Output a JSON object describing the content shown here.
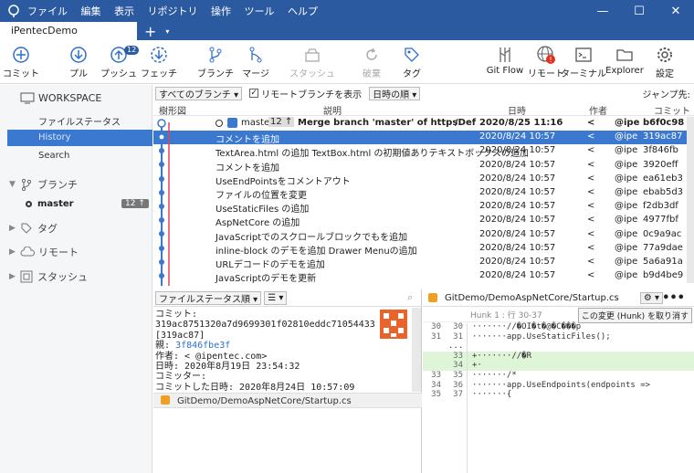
{
  "menu": {
    "items": [
      "ファイル",
      "編集",
      "表示",
      "リポジトリ",
      "操作",
      "ツール",
      "ヘルプ"
    ]
  },
  "window": {
    "min": "—",
    "max": "☐",
    "close": "✕"
  },
  "tab": {
    "title": "iPentecDemo",
    "plus": "+",
    "drop": "▾"
  },
  "toolbar": {
    "commit": "コミット",
    "pull": "プル",
    "push": "プッシュ",
    "push_badge": "12",
    "fetch": "フェッチ",
    "branch": "ブランチ",
    "merge": "マージ",
    "stash": "スタッシュ",
    "discard": "破棄",
    "tag": "タグ",
    "gitflow": "Git Flow",
    "remote": "リモート",
    "terminal": "ターミナル",
    "explorer": "Explorer",
    "settings": "設定"
  },
  "sidebar": {
    "workspace": "WORKSPACE",
    "file_status": "ファイルステータス",
    "history": "History",
    "search": "Search",
    "branches": "ブランチ",
    "master": "master",
    "master_badge": "12 ↑",
    "tags": "タグ",
    "remotes": "リモート",
    "stashes": "スタッシュ"
  },
  "histbar": {
    "branches_dd": "すべてのブランチ ▾",
    "show_remote": "リモートブランチを表示",
    "order_dd": "日時の順 ▾",
    "jump": "ジャンプ先:"
  },
  "columns": {
    "graph": "樹形図",
    "desc": "説明",
    "date": "日時",
    "author": "作者",
    "commit": "コミット"
  },
  "commits": [
    {
      "branch": "master",
      "badge": "12 ↑",
      "desc": "Merge branch 'master' of https:",
      "path": "/Def",
      "date": "2020/8/25 11:16",
      "author": "<",
      "email": "@ipe",
      "hash": "b6f0c98"
    },
    {
      "desc": "コメントを追加",
      "date": "2020/8/24 10:57",
      "author": "<",
      "email": "@ipe",
      "hash": "319ac87"
    },
    {
      "desc": "TextArea.html の追加 TextBox.html の初期値ありテキストボックスの追加",
      "date": "2020/8/24 10:57",
      "author": "<",
      "email": "@ipe",
      "hash": "3f846fb"
    },
    {
      "desc": "コメントを追加",
      "date": "2020/8/24 10:57",
      "author": "<",
      "email": "@ipe",
      "hash": "3920eff"
    },
    {
      "desc": "UseEndPointsをコメントアウト",
      "date": "2020/8/24 10:57",
      "author": "<",
      "email": "@ipe",
      "hash": "ea61eb3"
    },
    {
      "desc": "ファイルの位置を変更",
      "date": "2020/8/24 10:57",
      "author": "<",
      "email": "@ipe",
      "hash": "ebab5d3"
    },
    {
      "desc": "UseStaticFiles の追加",
      "date": "2020/8/24 10:57",
      "author": "<",
      "email": "@ipe",
      "hash": "f2db3df"
    },
    {
      "desc": "AspNetCore の追加",
      "date": "2020/8/24 10:57",
      "author": "<",
      "email": "@ipe",
      "hash": "4977fbf"
    },
    {
      "desc": "JavaScriptでのスクロールブロックでもを追加",
      "date": "2020/8/24 10:57",
      "author": "<",
      "email": "@ipe",
      "hash": "0c9a9ac"
    },
    {
      "desc": "inline-block のデモを追加 Drawer Menuの追加",
      "date": "2020/8/24 10:57",
      "author": "<",
      "email": "@ipe",
      "hash": "77a9dae"
    },
    {
      "desc": "URLデコードのデモを追加",
      "date": "2020/8/24 10:57",
      "author": "<",
      "email": "@ipe",
      "hash": "5a6a91a"
    },
    {
      "desc": "JavaScriptのデモを更新",
      "date": "2020/8/24 10:57",
      "author": "<",
      "email": "@ipe",
      "hash": "b9d4be9"
    }
  ],
  "fileview": {
    "sort_dd": "ファイルステータス順 ▾",
    "list_dd": "☰ ▾"
  },
  "commitinfo": {
    "l1": "コミット:",
    "l2": "319ac8751320a7d9699301f02810eddc71054433",
    "l3": "[319ac87]",
    "l4_label": "親:",
    "l4_val": "3f846fbe3f",
    "l5": "作者:       <      @ipentec.com>",
    "l6": "日時: 2020年8月19日 23:54:32",
    "l7": "コミッター:",
    "l8": "コミットした日時: 2020年8月24日 10:57:09"
  },
  "file": {
    "path": "GitDemo/DemoAspNetCore/Startup.cs"
  },
  "diff": {
    "path": "GitDemo/DemoAspNetCore/Startup.cs",
    "hunk": "Hunk 1 : 行 30-37",
    "discard": "この変更 (Hunk) を取り消す",
    "lines": [
      {
        "a": "30",
        "b": "30",
        "t": "·······//�OI�t�@�C���p",
        "k": "ctx"
      },
      {
        "a": "31",
        "b": "31",
        "t": "·······app.UseStaticFiles();",
        "k": "ctx"
      },
      {
        "a": "",
        "b": "",
        "t": "...",
        "k": "hdr"
      },
      {
        "a": "",
        "b": "33",
        "t": "+·······//�R",
        "k": "add"
      },
      {
        "a": "",
        "b": "34",
        "t": "+·",
        "k": "add"
      },
      {
        "a": "33",
        "b": "35",
        "t": "·······/*",
        "k": "ctx"
      },
      {
        "a": "34",
        "b": "36",
        "t": "·······app.UseEndpoints(endpoints =>",
        "k": "ctx"
      },
      {
        "a": "35",
        "b": "37",
        "t": "·······{",
        "k": "ctx"
      }
    ]
  }
}
